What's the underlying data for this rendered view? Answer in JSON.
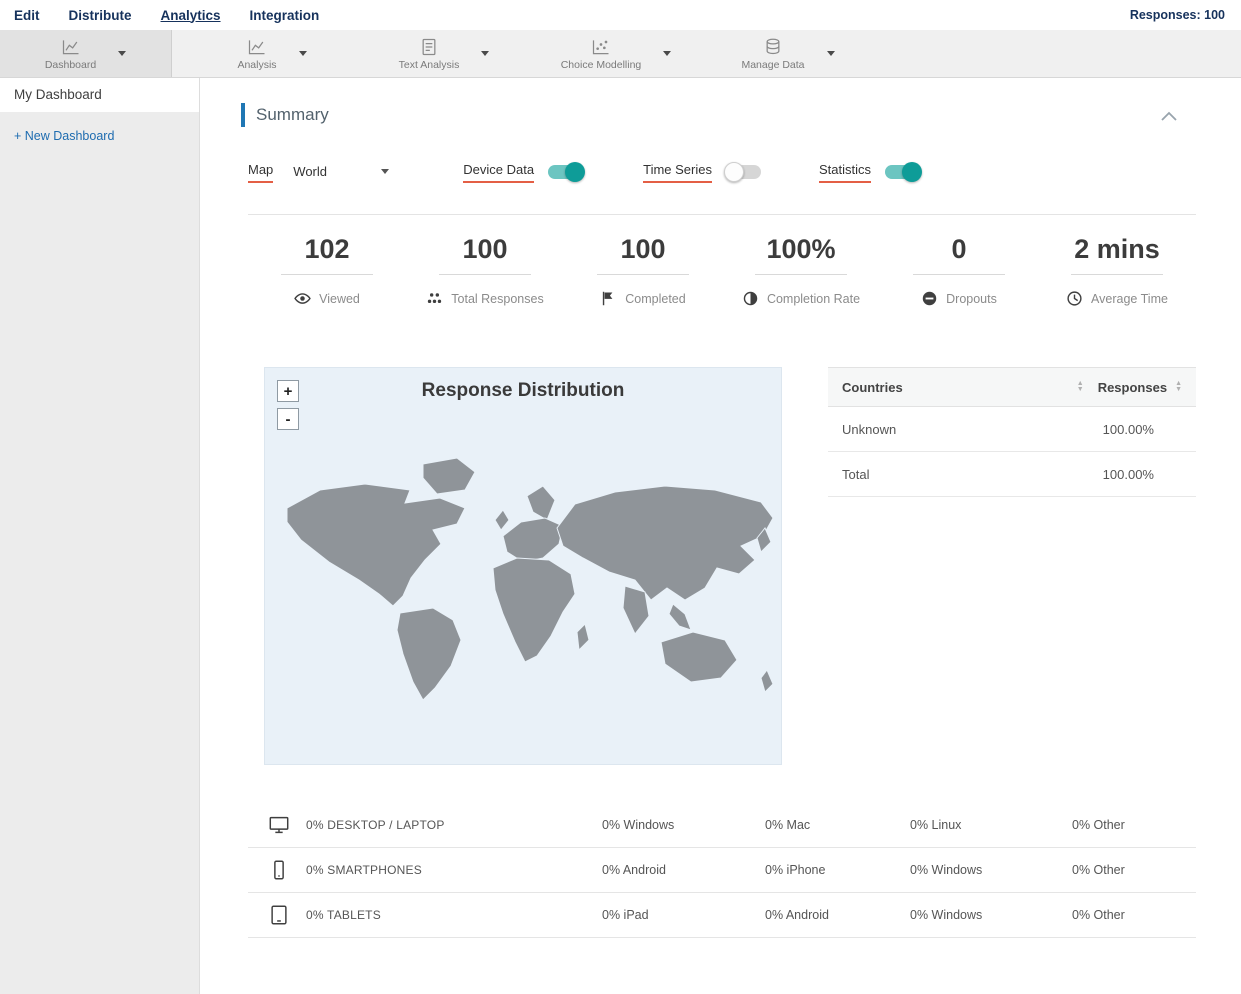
{
  "topnav": {
    "items": [
      {
        "label": "Edit",
        "active": false
      },
      {
        "label": "Distribute",
        "active": false
      },
      {
        "label": "Analytics",
        "active": true
      },
      {
        "label": "Integration",
        "active": false
      }
    ],
    "responses": "Responses: 100"
  },
  "toolbar": {
    "items": [
      {
        "label": "Dashboard",
        "icon": "line-chart-icon",
        "active": true
      },
      {
        "label": "Analysis",
        "icon": "line-chart-icon",
        "active": false
      },
      {
        "label": "Text Analysis",
        "icon": "document-chart-icon",
        "active": false
      },
      {
        "label": "Choice Modelling",
        "icon": "scatter-chart-icon",
        "active": false
      },
      {
        "label": "Manage Data",
        "icon": "database-icon",
        "active": false
      }
    ]
  },
  "sidebar": {
    "items": [
      {
        "label": "My Dashboard",
        "active": true
      }
    ],
    "new_dashboard": "+ New Dashboard"
  },
  "summary": {
    "title": "Summary",
    "controls": {
      "map": {
        "label": "Map",
        "value": "World"
      },
      "device_data": {
        "label": "Device Data",
        "on": true
      },
      "time_series": {
        "label": "Time Series",
        "on": false
      },
      "statistics": {
        "label": "Statistics",
        "on": true
      }
    },
    "stats": [
      {
        "value": "102",
        "label": "Viewed",
        "icon": "eye-icon"
      },
      {
        "value": "100",
        "label": "Total Responses",
        "icon": "group-dots-icon"
      },
      {
        "value": "100",
        "label": "Completed",
        "icon": "flag-icon"
      },
      {
        "value": "100%",
        "label": "Completion Rate",
        "icon": "half-circle-icon"
      },
      {
        "value": "0",
        "label": "Dropouts",
        "icon": "minus-circle-icon"
      },
      {
        "value": "2 mins",
        "label": "Average Time",
        "icon": "clock-icon"
      }
    ],
    "map": {
      "title": "Response Distribution",
      "zoom_in": "+",
      "zoom_out": "-"
    },
    "countries_table": {
      "col_country": "Countries",
      "col_responses": "Responses",
      "rows": [
        {
          "country": "Unknown",
          "responses": "100.00%"
        },
        {
          "country": "Total",
          "responses": "100.00%"
        }
      ]
    },
    "device_table": {
      "rows": [
        {
          "icon": "desktop-icon",
          "category": "0% DESKTOP / LAPTOP",
          "values": [
            "0% Windows",
            "0% Mac",
            "0% Linux",
            "0% Other"
          ]
        },
        {
          "icon": "smartphone-icon",
          "category": "0% SMARTPHONES",
          "values": [
            "0% Android",
            "0% iPhone",
            "0% Windows",
            "0% Other"
          ]
        },
        {
          "icon": "tablet-icon",
          "category": "0% TABLETS",
          "values": [
            "0% iPad",
            "0% Android",
            "0% Windows",
            "0% Other"
          ]
        }
      ]
    }
  },
  "colors": {
    "nav_blue": "#16325c",
    "accent_blue": "#2077b4",
    "toggle_teal": "#0e9c98",
    "highlight_red": "#e45f45",
    "map_bg": "#e9f1f8",
    "map_land": "#8f9499"
  }
}
